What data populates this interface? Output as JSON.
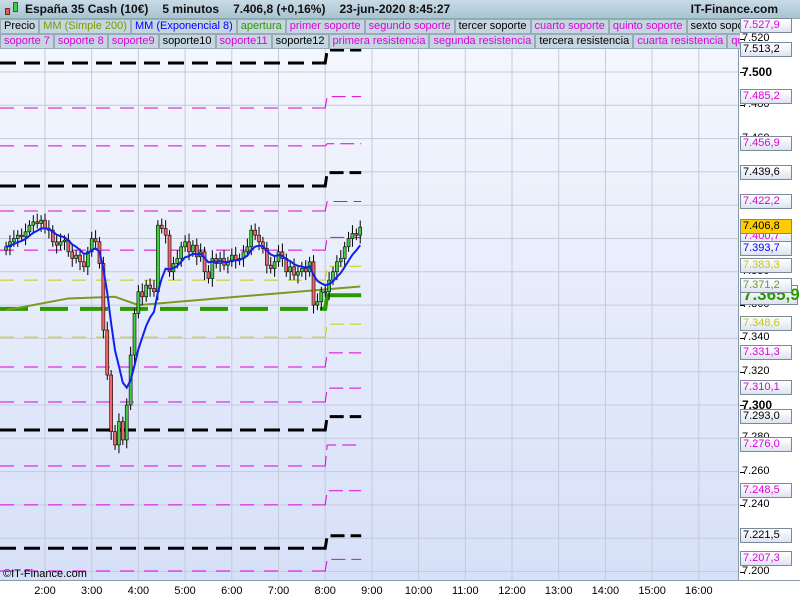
{
  "header": {
    "instrument": "España 35 Cash (10€)",
    "timeframe": "5 minutos",
    "price": "7.406,8 (+0,16%)",
    "datetime": "23-jun-2020 8:45:27",
    "brand": "IT-Finance.com"
  },
  "legend_row1": [
    {
      "label": "Precio",
      "color": "#000000"
    },
    {
      "label": "MM (Simple 200)",
      "color": "#7a9a00"
    },
    {
      "label": "MM (Exponencial 8)",
      "color": "#0000ff"
    },
    {
      "label": "apertura",
      "color": "#2a9a00"
    },
    {
      "label": "primer soporte",
      "color": "#dd00dd"
    },
    {
      "label": "segundo soporte",
      "color": "#dd00dd"
    },
    {
      "label": "tercer soporte",
      "color": "#000000"
    },
    {
      "label": "cuarto soporte",
      "color": "#dd00dd"
    },
    {
      "label": "quinto soporte",
      "color": "#dd00dd"
    },
    {
      "label": "sexto soporte",
      "color": "#000000"
    }
  ],
  "legend_row2": [
    {
      "label": "soporte 7",
      "color": "#dd00dd"
    },
    {
      "label": "soporte 8",
      "color": "#dd00dd"
    },
    {
      "label": "soporte9",
      "color": "#dd00dd"
    },
    {
      "label": "soporte10",
      "color": "#000000"
    },
    {
      "label": "soporte11",
      "color": "#dd00dd"
    },
    {
      "label": "soporte12",
      "color": "#000000"
    },
    {
      "label": "primera resistencia",
      "color": "#dd00dd"
    },
    {
      "label": "segunda resistencia",
      "color": "#dd00dd"
    },
    {
      "label": "tercera resistencia",
      "color": "#000000"
    },
    {
      "label": "cuarta resistencia",
      "color": "#dd00dd"
    },
    {
      "label": "quinta r",
      "color": "#dd00dd"
    }
  ],
  "copyright": "©IT-Finance.com",
  "chart_data": {
    "type": "candlestick",
    "ylim": [
      7190,
      7530
    ],
    "y_ticks": [
      "7.520",
      "7.500",
      "7.480",
      "7.460",
      "7.440",
      "7.420",
      "7.400",
      "7.380",
      "7.360",
      "7.340",
      "7.320",
      "7.300",
      "7.280",
      "7.260",
      "7.240",
      "7.220",
      "7.200"
    ],
    "x_ticks": [
      "2:00",
      "3:00",
      "4:00",
      "5:00",
      "6:00",
      "7:00",
      "8:00",
      "9:00",
      "10:00",
      "11:00",
      "12:00",
      "13:00",
      "14:00",
      "15:00",
      "16:00"
    ],
    "first_bar": "1:10",
    "bar_minutes": 5,
    "close": [
      7395,
      7398,
      7400,
      7402,
      7401,
      7404,
      7408,
      7410,
      7409,
      7411,
      7406,
      7405,
      7398,
      7396,
      7398,
      7399,
      7392,
      7388,
      7390,
      7386,
      7383,
      7392,
      7400,
      7398,
      7385,
      7345,
      7318,
      7284,
      7276,
      7290,
      7279,
      7300,
      7330,
      7355,
      7368,
      7365,
      7372,
      7370,
      7368,
      7408,
      7406,
      7402,
      7380,
      7385,
      7388,
      7395,
      7398,
      7392,
      7396,
      7389,
      7392,
      7380,
      7376,
      7388,
      7385,
      7388,
      7384,
      7386,
      7390,
      7387,
      7388,
      7392,
      7395,
      7405,
      7402,
      7398,
      7394,
      7384,
      7382,
      7386,
      7392,
      7388,
      7380,
      7383,
      7378,
      7380,
      7382,
      7380,
      7386,
      7360,
      7362,
      7368,
      7368,
      7375,
      7380,
      7386,
      7388,
      7395,
      7400,
      7403,
      7402,
      7406.8
    ],
    "sma200": [
      [
        "1:10",
        7357
      ],
      [
        "2:30",
        7364
      ],
      [
        "3:30",
        7365
      ],
      [
        "4:00",
        7360
      ],
      [
        "8:45",
        7371.2
      ]
    ],
    "levels": [
      {
        "color": "#000000",
        "prev": 7505.4,
        "today": 7513.2,
        "label": "7.513,2"
      },
      {
        "color": "#dd00dd",
        "prev": 7520,
        "today": 7527.9,
        "label": "7.527,9"
      },
      {
        "color": "#dd00dd",
        "prev": 7478.4,
        "today": 7485.2,
        "label": "7.485,2"
      },
      {
        "color": "#dd00dd",
        "prev": 7455.6,
        "today": 7456.9,
        "label": "7.456,9"
      },
      {
        "color": "#000000",
        "prev": 7431.5,
        "today": 7439.6,
        "label": "7.439,6"
      },
      {
        "color": "#dd00dd",
        "prev": 7416.5,
        "today": 7422.2,
        "label": "7.422,2"
      },
      {
        "color": "#dd00dd",
        "prev": 7393,
        "today": 7400.7,
        "label": "7.400,7"
      },
      {
        "color": "#cccc00",
        "prev": 7375,
        "today": 7383.3,
        "label": "7.383,3"
      },
      {
        "color": "#2a9a00",
        "prev": 7357.7,
        "today": 7365.9,
        "label": "7.365,9",
        "thick": true
      },
      {
        "color": "#cccc00",
        "prev": 7340.8,
        "today": 7348.6,
        "label": "7.348,6"
      },
      {
        "color": "#dd00dd",
        "prev": 7322.8,
        "today": 7331.3,
        "label": "7.331,3"
      },
      {
        "color": "#dd00dd",
        "prev": 7301.8,
        "today": 7310.1,
        "label": "7.310,1"
      },
      {
        "color": "#000000",
        "prev": 7285,
        "today": 7293.0,
        "label": "7.293,0"
      },
      {
        "color": "#dd00dd",
        "prev": 7263.4,
        "today": 7276.0,
        "label": "7.276,0"
      },
      {
        "color": "#dd00dd",
        "prev": 7240,
        "today": 7248.5,
        "label": "7.248,5"
      },
      {
        "color": "#000000",
        "prev": 7214,
        "today": 7221.5,
        "label": "7.221,5"
      },
      {
        "color": "#dd00dd",
        "prev": 7200.3,
        "today": 7207.3,
        "label": "7.207,3"
      }
    ],
    "markers": {
      "last_price": {
        "value": 7406.8,
        "label": "7.406,8",
        "bg": "#ffcc00"
      },
      "ema8": {
        "value": 7393.7,
        "label": "7.393,7",
        "color": "#0000ff"
      },
      "sma200": {
        "value": 7371.2,
        "label": "7.371,2",
        "color": "#6a9a20"
      }
    }
  }
}
